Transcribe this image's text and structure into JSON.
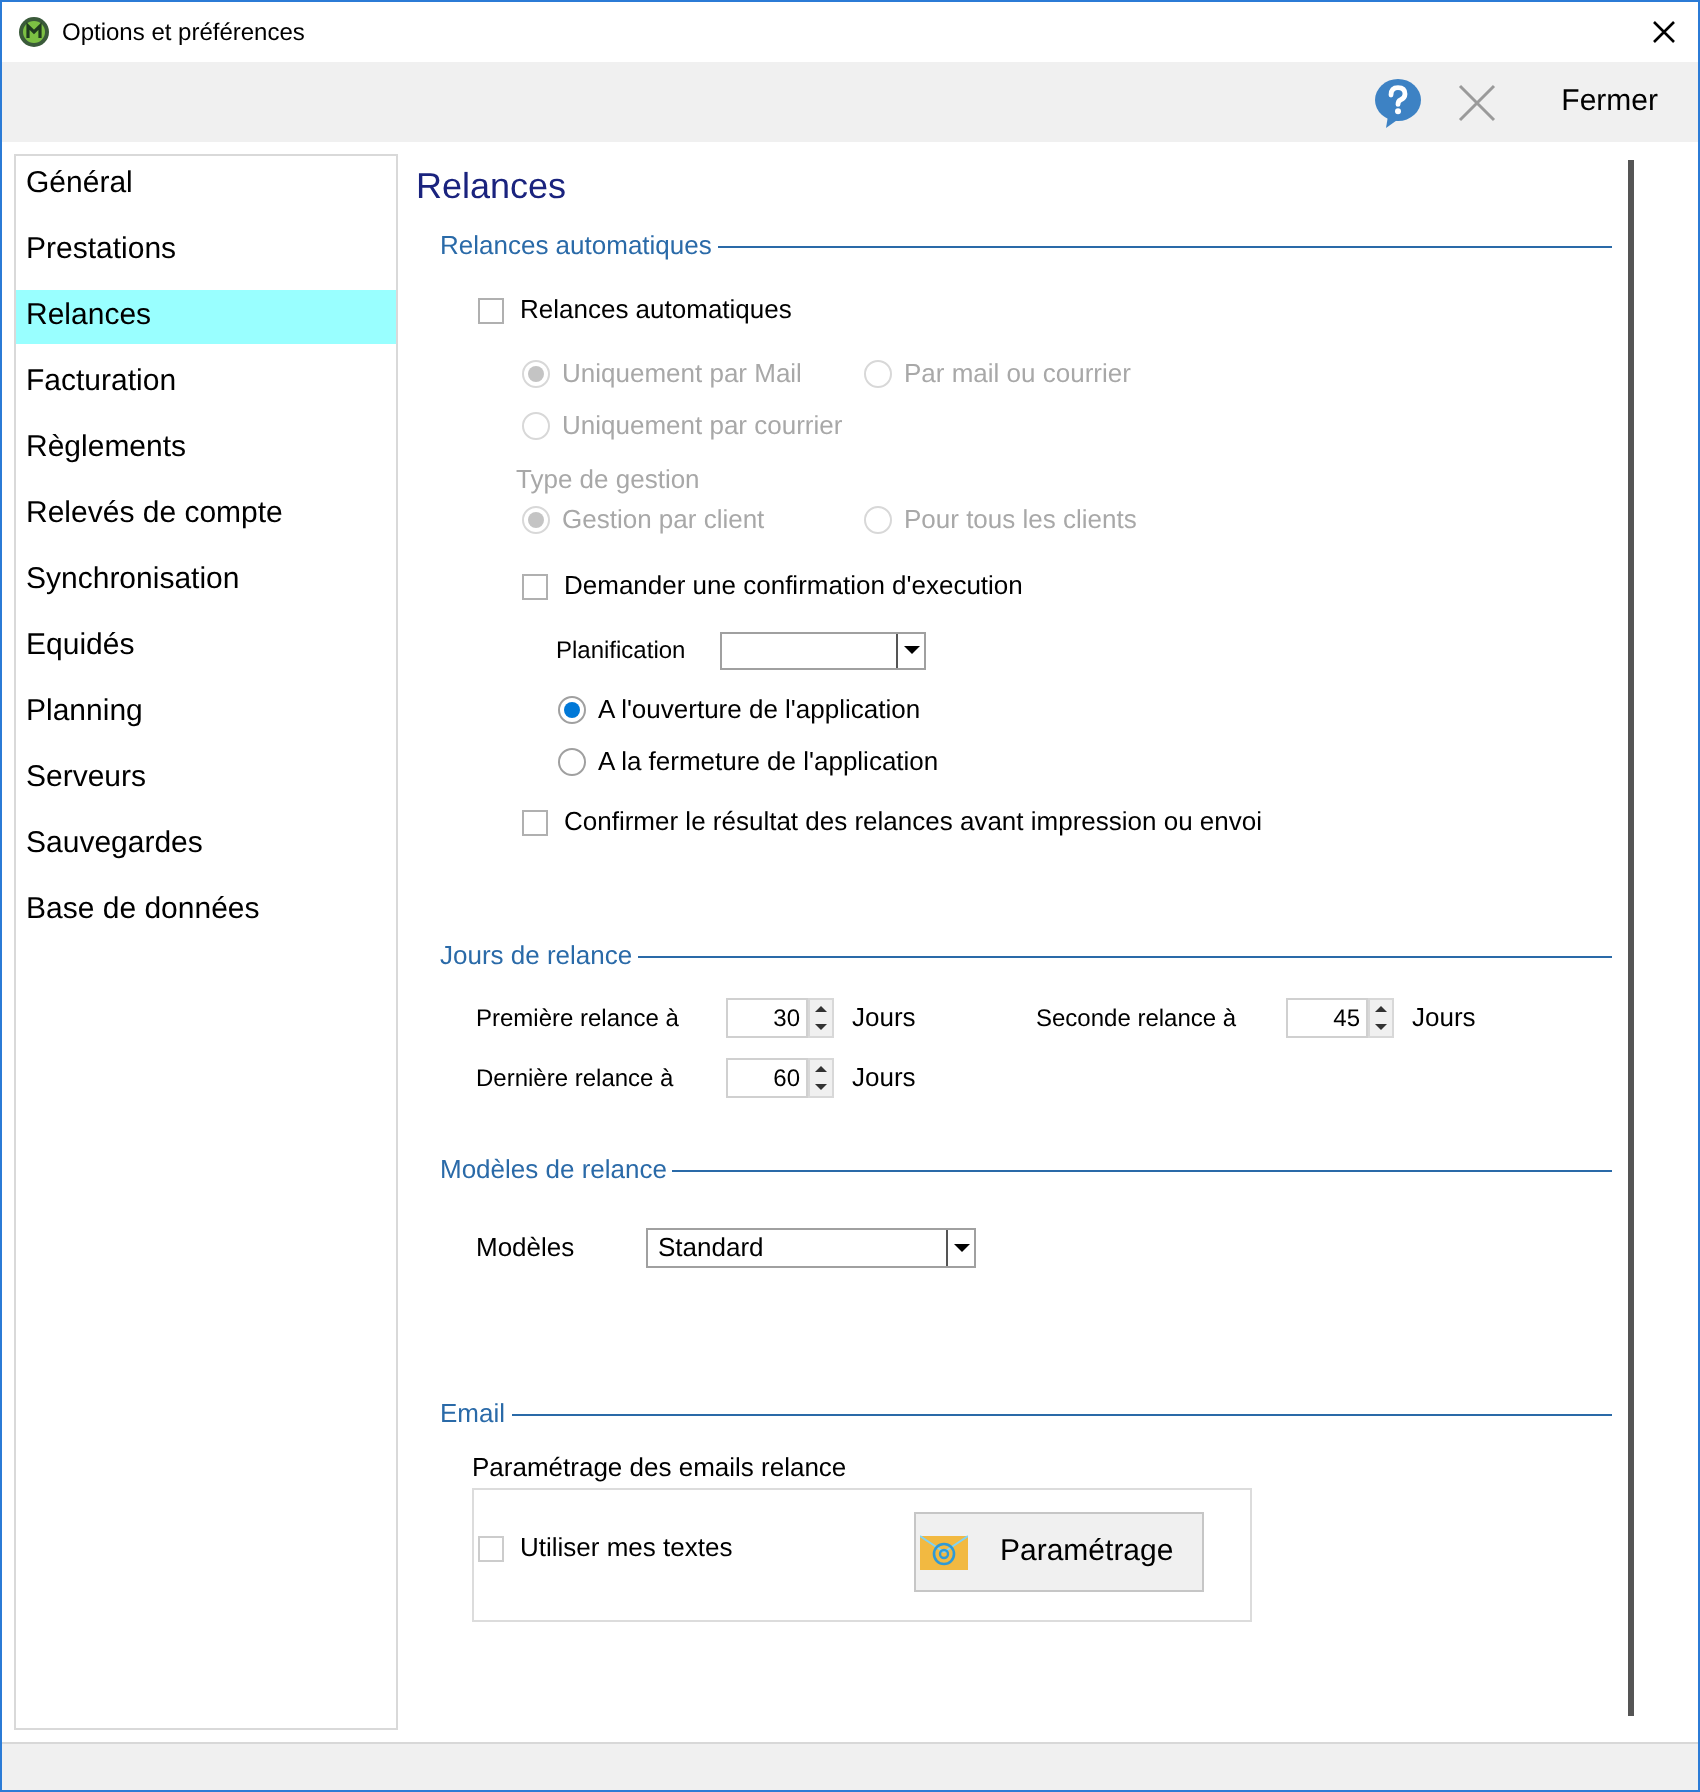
{
  "window": {
    "title": "Options et préférences"
  },
  "toolbar": {
    "close_label": "Fermer"
  },
  "sidebar": {
    "items": [
      {
        "label": "Général",
        "selected": false
      },
      {
        "label": "Prestations",
        "selected": false
      },
      {
        "label": "Relances",
        "selected": true
      },
      {
        "label": "Facturation",
        "selected": false
      },
      {
        "label": "Règlements",
        "selected": false
      },
      {
        "label": "Relevés de compte",
        "selected": false
      },
      {
        "label": "Synchronisation",
        "selected": false
      },
      {
        "label": "Equidés",
        "selected": false
      },
      {
        "label": "Planning",
        "selected": false
      },
      {
        "label": "Serveurs",
        "selected": false
      },
      {
        "label": "Sauvegardes",
        "selected": false
      },
      {
        "label": "Base de données",
        "selected": false
      }
    ]
  },
  "page": {
    "title": "Relances",
    "auto": {
      "heading": "Relances automatiques",
      "enable": {
        "label": "Relances automatiques",
        "checked": false
      },
      "send_mode": [
        {
          "label": "Uniquement par Mail",
          "selected": true,
          "disabled": true
        },
        {
          "label": "Par mail ou courrier",
          "selected": false,
          "disabled": true
        },
        {
          "label": "Uniquement par courrier",
          "selected": false,
          "disabled": true
        }
      ],
      "management_label": {
        "text": "Type de gestion",
        "disabled": true
      },
      "management": [
        {
          "label": "Gestion par client",
          "selected": true,
          "disabled": true
        },
        {
          "label": "Pour tous les clients",
          "selected": false,
          "disabled": true
        }
      ],
      "confirm_execution": {
        "label": "Demander une confirmation d'execution",
        "checked": false
      },
      "planning": {
        "label": "Planification"
      },
      "planning_options": [
        {
          "label": "A l'ouverture de l'application",
          "selected": true,
          "disabled": false
        },
        {
          "label": "A la fermeture de l'application",
          "selected": false,
          "disabled": false
        }
      ],
      "confirm_result": {
        "label": "Confirmer le résultat des relances avant impression ou envoi",
        "checked": false
      }
    },
    "days": {
      "heading": "Jours de relance",
      "fields": [
        {
          "label": "Première relance à",
          "value": "30",
          "unit": "Jours"
        },
        {
          "label": "Seconde relance à",
          "value": "45",
          "unit": "Jours"
        },
        {
          "label": "Dernière relance à",
          "value": "60",
          "unit": "Jours"
        }
      ]
    },
    "templates": {
      "heading": "Modèles de relance",
      "label": "Modèles",
      "value": "Standard"
    },
    "email": {
      "heading": "Email",
      "group_label": "Paramétrage des emails relance",
      "use_texts": {
        "label": "Utiliser mes textes",
        "checked": false
      },
      "button": "Paramétrage"
    }
  }
}
